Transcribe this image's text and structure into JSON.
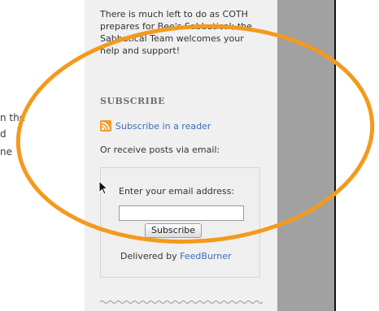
{
  "main_column": {
    "fragments": [
      "n the",
      "d",
      "ne"
    ]
  },
  "sidebar": {
    "intro_text": "There is much left to do as COTH prepares for Bee's Sabbatical; the Sabbatical Team welcomes your help and support!",
    "subscribe_heading": "SUBSCRIBE",
    "rss_link_label": "Subscribe in a reader",
    "email_note": "Or receive posts via email:",
    "form": {
      "label": "Enter your email address:",
      "input_value": "",
      "button_label": "Subscribe",
      "delivered_prefix": "Delivered by ",
      "delivered_link": "FeedBurner"
    }
  },
  "colors": {
    "annotation_ellipse": "#f39a1e",
    "sidebar_bg": "#f0f0f0",
    "gray_bar": "#a1a1a1",
    "link": "#3e6cb5",
    "rss_icon": "#f39a31"
  },
  "icons": {
    "rss": "rss-icon",
    "cursor": "mouse-pointer-icon"
  }
}
